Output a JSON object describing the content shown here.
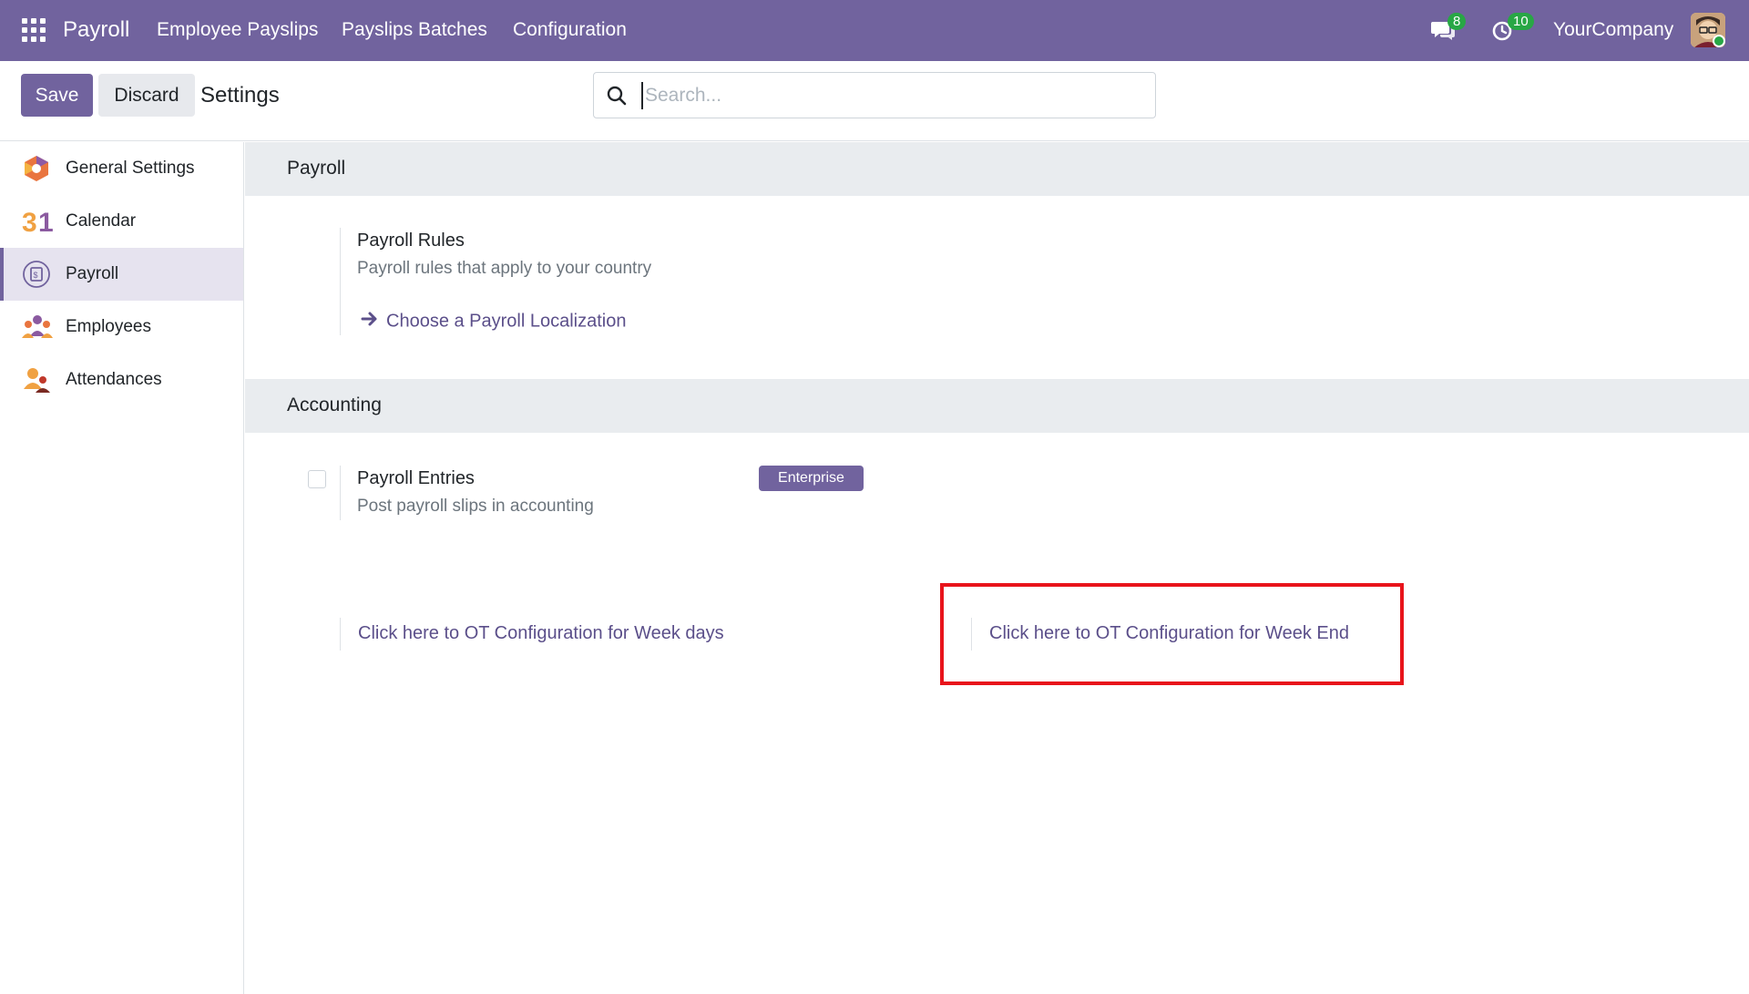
{
  "navbar": {
    "brand": "Payroll",
    "menu": [
      "Employee Payslips",
      "Payslips Batches",
      "Configuration"
    ],
    "messages_count": "8",
    "activities_count": "10",
    "company": "YourCompany"
  },
  "control": {
    "save_label": "Save",
    "discard_label": "Discard",
    "title": "Settings",
    "search_placeholder": "Search..."
  },
  "sidebar": {
    "items": [
      {
        "label": "General Settings",
        "icon": "general-settings-icon"
      },
      {
        "label": "Calendar",
        "icon": "calendar-icon"
      },
      {
        "label": "Payroll",
        "icon": "payroll-icon",
        "active": true
      },
      {
        "label": "Employees",
        "icon": "employees-icon"
      },
      {
        "label": "Attendances",
        "icon": "attendances-icon"
      }
    ]
  },
  "main": {
    "payroll_section": {
      "title": "Payroll",
      "rules_title": "Payroll Rules",
      "rules_desc": "Payroll rules that apply to your country",
      "localization_link": "Choose a Payroll Localization"
    },
    "accounting_section": {
      "title": "Accounting",
      "entries_title": "Payroll Entries",
      "entries_desc": "Post payroll slips in accounting",
      "entries_checked": false,
      "enterprise_badge": "Enterprise",
      "ot_weekdays_link": "Click here to OT Configuration for Week days",
      "ot_weekend_link": "Click here to OT Configuration for Week End"
    }
  },
  "colors": {
    "brand": "#71639e",
    "link": "#5b4f8a",
    "highlight": "#e8141b",
    "badge": "#28a745"
  }
}
